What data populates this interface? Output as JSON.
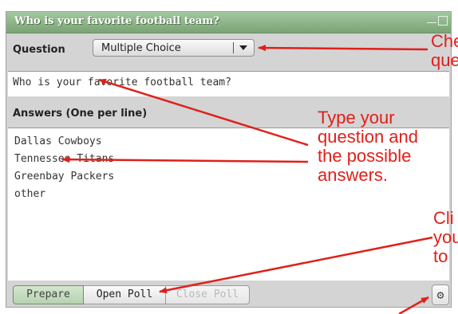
{
  "window": {
    "title": "Who is your favorite football team?"
  },
  "question": {
    "label": "Question",
    "type_selected": "Multiple Choice",
    "text": "Who is your favorite football team?"
  },
  "answers": {
    "label": "Answers (One per line)",
    "lines": [
      "Dallas Cowboys",
      "Tennessee Titans",
      "Greenbay Packers",
      "other"
    ]
  },
  "toolbar": {
    "prepare_label": "Prepare",
    "open_label": "Open Poll",
    "close_label": "Close Poll",
    "gear_icon": "gear-icon"
  },
  "annotations": {
    "top_right": [
      "Che",
      "que"
    ],
    "middle": [
      "Type your",
      "question and",
      "the possible",
      "answers."
    ],
    "bottom_right": [
      "Cli",
      "you",
      "to"
    ]
  },
  "colors": {
    "titlebar": "#7aa475",
    "annotation": "#e0201a",
    "panel_bg": "#d4d4d4"
  }
}
